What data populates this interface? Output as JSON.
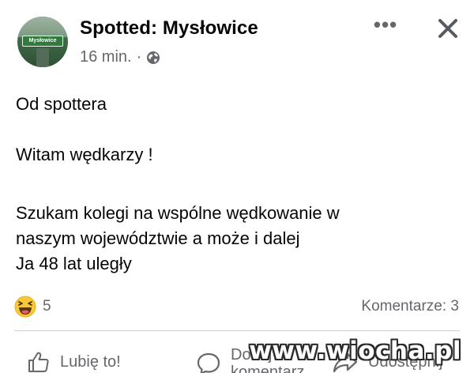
{
  "post": {
    "author": "Spotted: Mysłowice",
    "avatar_sign_text": "Mysłowice",
    "time": "16 min.",
    "separator": "·",
    "visibility_icon": "globe-icon",
    "more_icon": "more-options-icon",
    "more_label": "•••",
    "close_icon": "close-icon",
    "body": {
      "line1": "Od spottera",
      "line2": "Witam wędkarzy !",
      "line3a": "Szukam kolegi na wspólne wędkowanie w",
      "line3b": "naszym województwie a może i dalej",
      "line3c": "Ja 48 lat uległy"
    }
  },
  "reactions": {
    "icon": "haha-reaction-icon",
    "count": "5",
    "comments": "Komentarze: 3"
  },
  "actions": {
    "like": "Lubię to!",
    "comment_line1": "Dodaj",
    "comment_line2": "komentarz",
    "share": "Udostępnij"
  },
  "watermark": "www.wiocha.pl",
  "colors": {
    "text": "#050505",
    "secondary": "#65676b",
    "divider": "#ced0d4",
    "haha_yellow": "#f7c83a"
  }
}
